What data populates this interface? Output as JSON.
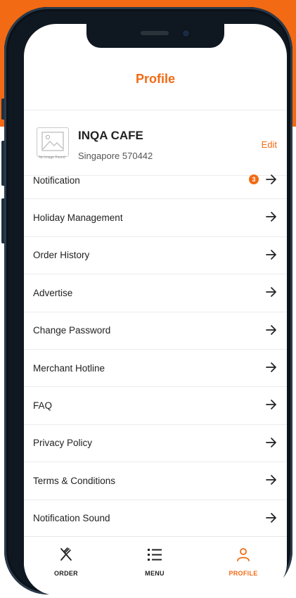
{
  "header": {
    "title": "Profile"
  },
  "profile": {
    "name": "INQA CAFE",
    "address": "Singapore 570442",
    "image_caption": "No Image Found",
    "edit_label": "Edit"
  },
  "menu": {
    "notification": "Notification",
    "notification_badge": "3",
    "holiday": "Holiday Management",
    "order_history": "Order History",
    "advertise": "Advertise",
    "change_password": "Change Password",
    "hotline": "Merchant Hotline",
    "faq": "FAQ",
    "privacy": "Privacy Policy",
    "terms": "Terms & Conditions",
    "notification_sound": "Notification Sound"
  },
  "tabs": {
    "order": "ORDER",
    "menu": "MENU",
    "profile": "PROFILE",
    "active": "profile"
  },
  "colors": {
    "accent": "#f26a14"
  }
}
